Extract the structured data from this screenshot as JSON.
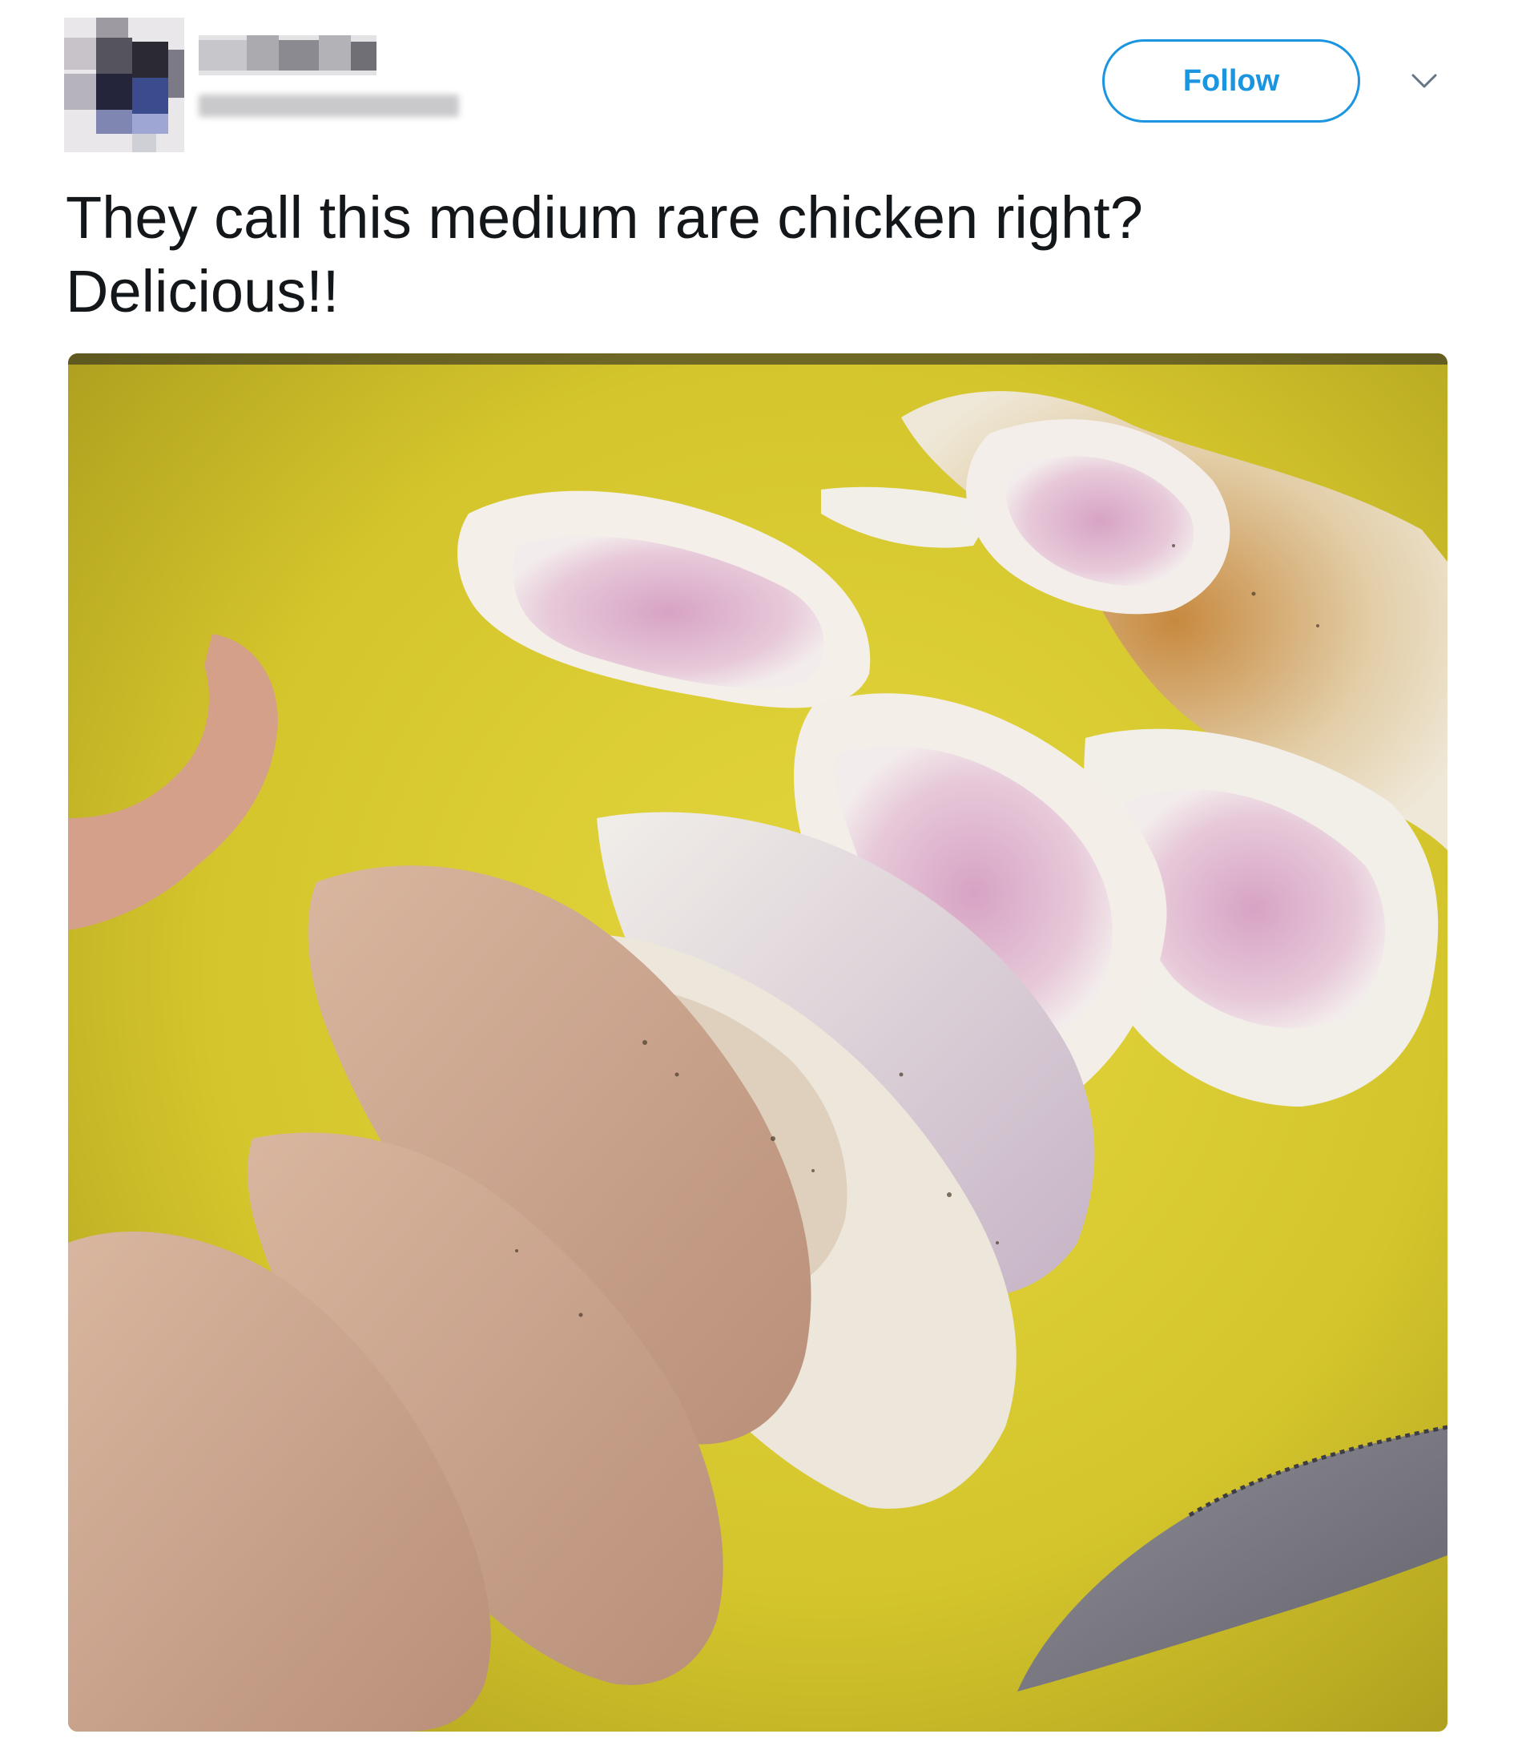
{
  "tweet": {
    "follow_label": "Follow",
    "text_line1": "They call this medium rare chicken right?",
    "text_line2": "Delicious!!"
  },
  "icons": {
    "more_options": "chevron-down-icon"
  },
  "colors": {
    "accent": "#1b95e0",
    "text": "#14171a",
    "board": "#d8cc2f"
  }
}
